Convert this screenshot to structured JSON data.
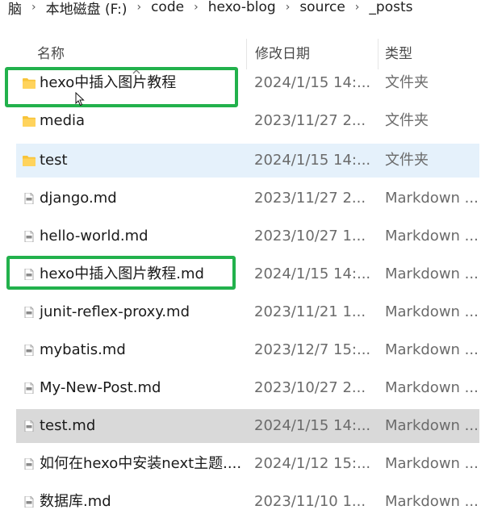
{
  "breadcrumb": {
    "items": [
      "脑",
      "本地磁盘 (F:)",
      "code",
      "hexo-blog",
      "source",
      "_posts"
    ]
  },
  "columns": {
    "name": "名称",
    "modified": "修改日期",
    "type": "类型"
  },
  "files": [
    {
      "name": "hexo中插入图片教程",
      "date": "2024/1/15 14:...",
      "type": "文件夹",
      "icon": "folder-icon"
    },
    {
      "name": "media",
      "date": "2023/11/27 2...",
      "type": "文件夹",
      "icon": "folder-icon"
    },
    {
      "name": "test",
      "date": "2024/1/15 14:...",
      "type": "文件夹",
      "icon": "folder-icon"
    },
    {
      "name": "django.md",
      "date": "2023/11/27 2...",
      "type": "Markdown ...",
      "icon": "markdown-file-icon"
    },
    {
      "name": "hello-world.md",
      "date": "2023/10/27 1...",
      "type": "Markdown ...",
      "icon": "markdown-file-icon"
    },
    {
      "name": "hexo中插入图片教程.md",
      "date": "2024/1/15 14:...",
      "type": "Markdown ...",
      "icon": "markdown-file-icon"
    },
    {
      "name": "junit-reflex-proxy.md",
      "date": "2023/11/21 1...",
      "type": "Markdown ...",
      "icon": "markdown-file-icon"
    },
    {
      "name": "mybatis.md",
      "date": "2023/12/7 15:...",
      "type": "Markdown ...",
      "icon": "markdown-file-icon"
    },
    {
      "name": "My-New-Post.md",
      "date": "2023/10/27 2...",
      "type": "Markdown ...",
      "icon": "markdown-file-icon"
    },
    {
      "name": "test.md",
      "date": "2024/1/15 14:...",
      "type": "Markdown ...",
      "icon": "markdown-file-icon"
    },
    {
      "name": "如何在hexo中安装next主题....",
      "date": "2024/1/12 15:...",
      "type": "Markdown ...",
      "icon": "markdown-file-icon"
    },
    {
      "name": "数据库.md",
      "date": "2023/11/10 1...",
      "type": "Markdown ...",
      "icon": "markdown-file-icon"
    }
  ],
  "colors": {
    "folder": "#f8c43a",
    "hover_row": "#e5f1fb",
    "selected_row": "#d9d9d9",
    "highlight_box": "#22b14c"
  }
}
